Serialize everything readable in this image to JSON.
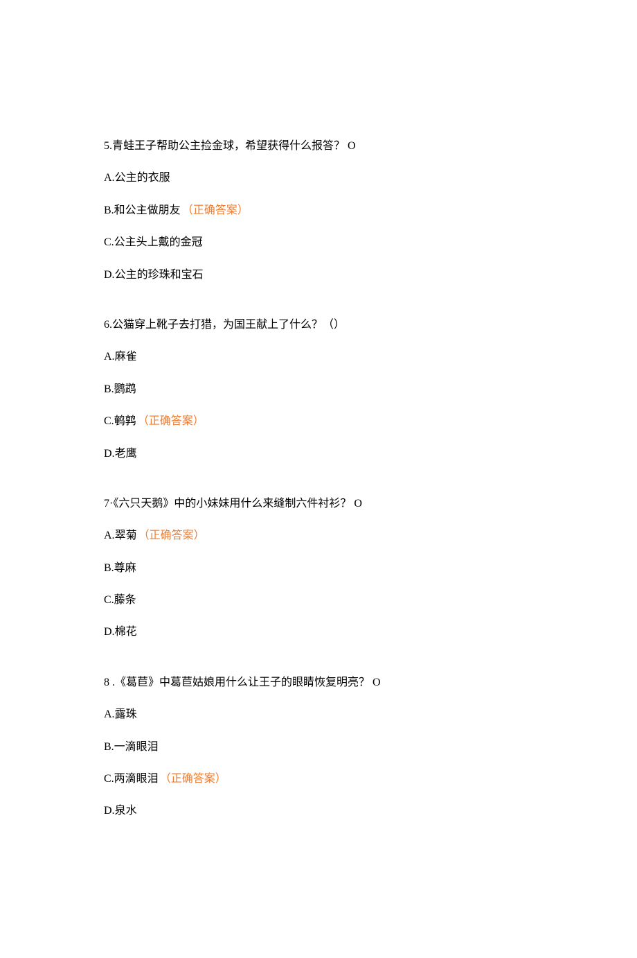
{
  "questions": [
    {
      "number": "5.",
      "text": "青蛙王子帮助公主捡金球，希望获得什么报答？ O",
      "options": [
        {
          "label": "A.",
          "text": "公主的衣服",
          "correct": false
        },
        {
          "label": "B.",
          "text": "和公主做朋友",
          "correct": true
        },
        {
          "label": "C.",
          "text": "公主头上戴的金冠",
          "correct": false
        },
        {
          "label": "D.",
          "text": "公主的珍珠和宝石",
          "correct": false
        }
      ]
    },
    {
      "number": "6.",
      "text": "公猫穿上靴子去打猎，为国王献上了什么？（）",
      "options": [
        {
          "label": "A.",
          "text": "麻雀",
          "correct": false
        },
        {
          "label": "B.",
          "text": "鹦鹉",
          "correct": false
        },
        {
          "label": "C.",
          "text": "鹌鹑",
          "correct": true
        },
        {
          "label": "D.",
          "text": "老鹰",
          "correct": false
        }
      ]
    },
    {
      "number": "7·",
      "text": "《六只天鹅》中的小妹妹用什么来缝制六件衬衫？ O",
      "options": [
        {
          "label": "A.",
          "text": "翠菊",
          "correct": true
        },
        {
          "label": "B.",
          "text": "尊麻",
          "correct": false
        },
        {
          "label": "C.",
          "text": "藤条",
          "correct": false
        },
        {
          "label": "D.",
          "text": "棉花",
          "correct": false
        }
      ]
    },
    {
      "number": "8 .",
      "text": "《葛苣》中葛苣姑娘用什么让王子的眼睛恢复明亮？ O",
      "options": [
        {
          "label": "A.",
          "text": "露珠",
          "correct": false
        },
        {
          "label": "B.",
          "text": "一滴眼泪",
          "correct": false
        },
        {
          "label": "C.",
          "text": "两滴眼泪",
          "correct": true
        },
        {
          "label": "D.",
          "text": "泉水",
          "correct": false
        }
      ]
    }
  ],
  "correctAnswerLabel": "（正确答案）"
}
